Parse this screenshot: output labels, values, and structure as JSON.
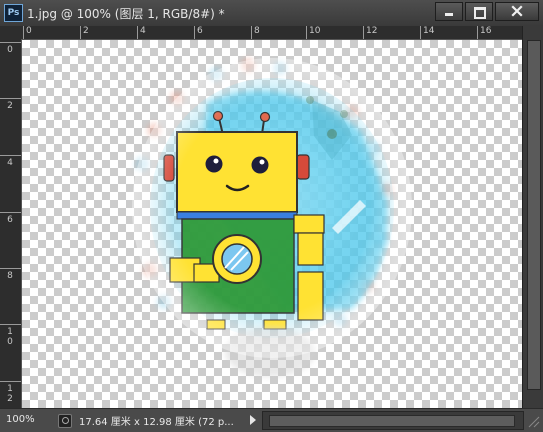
{
  "titlebar": {
    "app_icon_label": "Ps",
    "document_title": "1.jpg @ 100% (图层 1, RGB/8#) *",
    "buttons": [
      "minimize",
      "maximize",
      "close"
    ]
  },
  "rulers": {
    "horizontal_labels": [
      "0",
      "2",
      "4",
      "6",
      "8",
      "10",
      "12",
      "14",
      "16"
    ],
    "vertical_labels": [
      "0",
      "2",
      "4",
      "6",
      "8",
      "10",
      "12"
    ]
  },
  "statusbar": {
    "zoom": "100%",
    "doc_info": "17.64 厘米 x 12.98 厘米 (72 p..."
  },
  "icons": {
    "app": "photoshop-icon",
    "minimize": "minimize-icon",
    "maximize": "maximize-icon",
    "close": "close-icon",
    "status": "document-info-icon",
    "arrow": "chevron-right-icon"
  },
  "colors": {
    "robot_head": "#ffe233",
    "robot_body": "#2f9a3a",
    "background_glow": "#5ed0f0",
    "panel": "#3c3c3c"
  }
}
